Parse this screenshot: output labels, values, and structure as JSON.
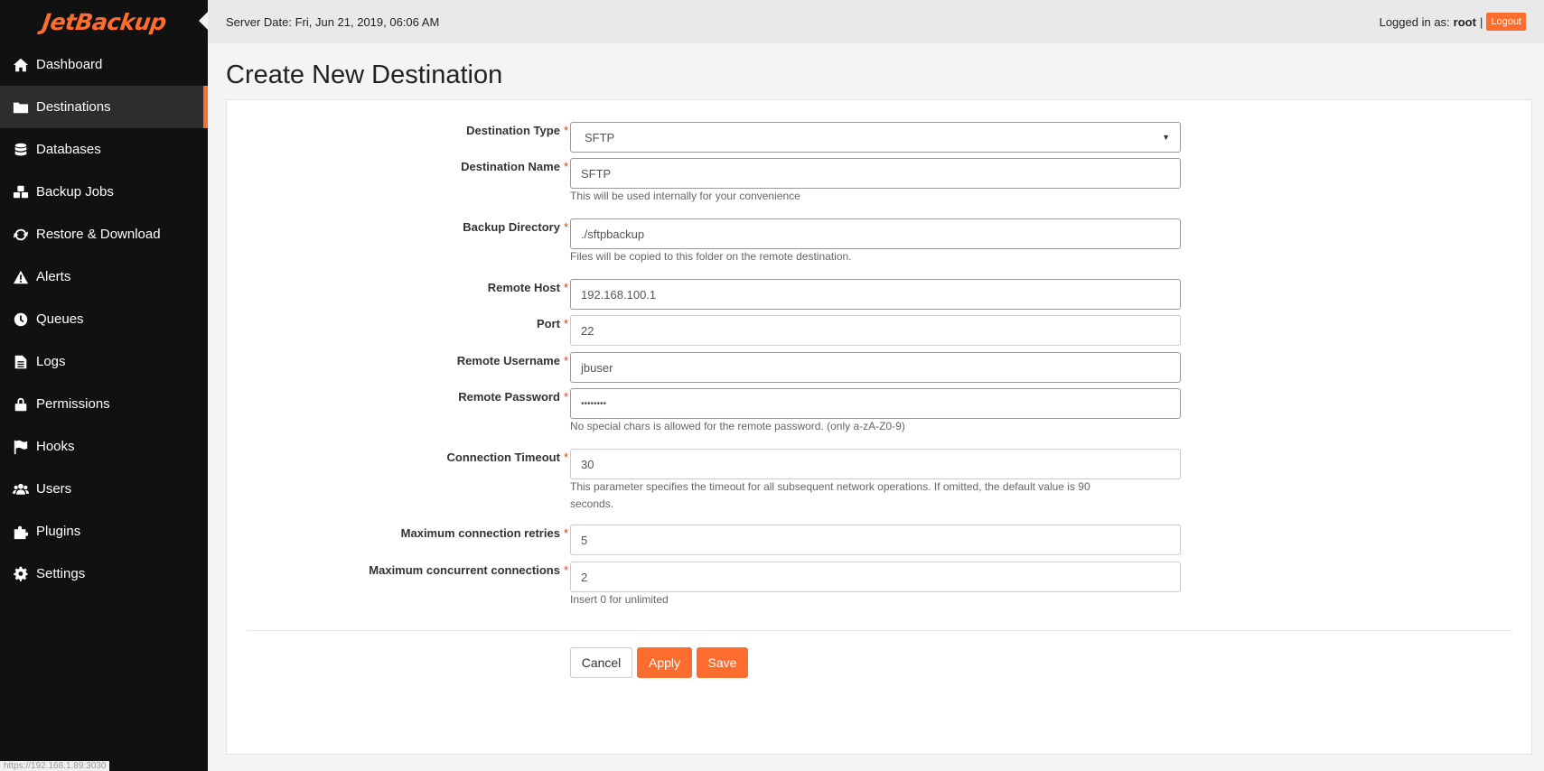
{
  "app": {
    "logo_text": "JetBackup",
    "brand_color": "#ff6d2e"
  },
  "sidebar": {
    "items": [
      {
        "label": "Dashboard",
        "icon": "home-icon"
      },
      {
        "label": "Destinations",
        "icon": "folder-icon",
        "active": true
      },
      {
        "label": "Databases",
        "icon": "database-icon"
      },
      {
        "label": "Backup Jobs",
        "icon": "cubes-icon"
      },
      {
        "label": "Restore & Download",
        "icon": "refresh-icon"
      },
      {
        "label": "Alerts",
        "icon": "warning-icon"
      },
      {
        "label": "Queues",
        "icon": "clock-icon"
      },
      {
        "label": "Logs",
        "icon": "file-icon"
      },
      {
        "label": "Permissions",
        "icon": "lock-icon"
      },
      {
        "label": "Hooks",
        "icon": "flag-icon"
      },
      {
        "label": "Users",
        "icon": "users-icon"
      },
      {
        "label": "Plugins",
        "icon": "puzzle-icon"
      },
      {
        "label": "Settings",
        "icon": "gear-icon"
      }
    ]
  },
  "topbar": {
    "server_date": "Server Date: Fri, Jun 21, 2019, 06:06 AM",
    "logged_in_prefix": "Logged in as:",
    "username": "root",
    "separator": "|",
    "logout_label": "Logout"
  },
  "page": {
    "title": "Create New Destination"
  },
  "form": {
    "required_mark": "*",
    "destination_type": {
      "label": "Destination Type",
      "value": "SFTP"
    },
    "destination_name": {
      "label": "Destination Name",
      "value": "SFTP",
      "help": "This will be used internally for your convenience"
    },
    "backup_directory": {
      "label": "Backup Directory",
      "value": "./sftpbackup",
      "help": "Files will be copied to this folder on the remote destination."
    },
    "remote_host": {
      "label": "Remote Host",
      "value": "192.168.100.1"
    },
    "port": {
      "label": "Port",
      "value": "22"
    },
    "remote_username": {
      "label": "Remote Username",
      "value": "jbuser"
    },
    "remote_password": {
      "label": "Remote Password",
      "value": "••••••••",
      "help": "No special chars is allowed for the remote password. (only a-zA-Z0-9)"
    },
    "connection_timeout": {
      "label": "Connection Timeout",
      "value": "30",
      "help": "This parameter specifies the timeout for all subsequent network operations. If omitted, the default value is 90 seconds."
    },
    "max_retries": {
      "label": "Maximum connection retries",
      "value": "5"
    },
    "max_concurrent": {
      "label": "Maximum concurrent connections",
      "value": "2",
      "help": "Insert 0 for unlimited"
    }
  },
  "buttons": {
    "cancel": "Cancel",
    "apply": "Apply",
    "save": "Save"
  },
  "statusbar": {
    "url": "https://192.168.1.89:3030"
  }
}
